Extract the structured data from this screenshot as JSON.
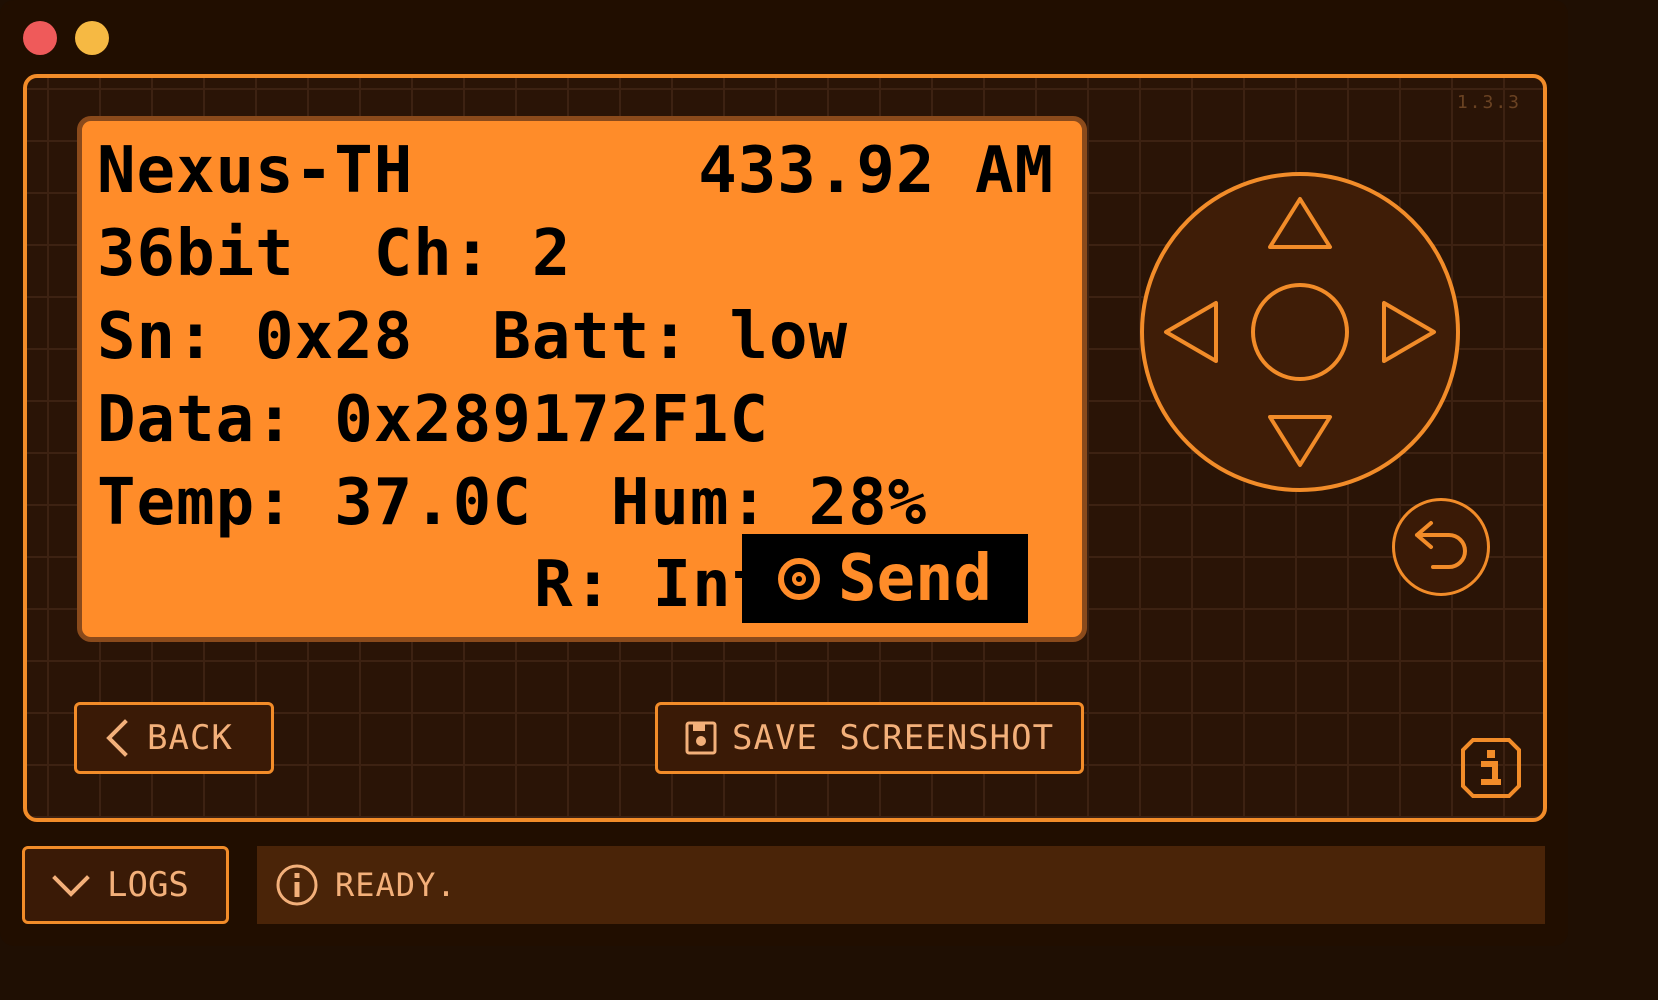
{
  "app": {
    "version": "1.3.3"
  },
  "lcd": {
    "protocol": "Nexus-TH",
    "frequency": "433.92 AM",
    "line2": "36bit  Ch: 2",
    "line3": "Sn: 0x28  Batt: low",
    "line4": "Data: 0x289172F1C",
    "line5": "Temp: 37.0C  Hum: 28%",
    "repeat": "R: Int",
    "send_label": "Send"
  },
  "controls": {
    "back_label": "BACK",
    "save_label": "SAVE SCREENSHOT"
  },
  "footer": {
    "logs_label": "LOGS",
    "status": "READY."
  },
  "colors": {
    "accent": "#f28c29",
    "lcd_background": "#ff8c29",
    "window_background": "#210e00",
    "text_light": "#f3b07a"
  },
  "icons": {
    "dpad": [
      "up-arrow-icon",
      "down-arrow-icon",
      "left-arrow-icon",
      "right-arrow-icon",
      "ok-center-icon"
    ],
    "back": "return-arrow-icon",
    "save": "floppy-icon",
    "info": "info-icon",
    "logs": "chevron-down-icon",
    "status": "info-circle-icon"
  }
}
